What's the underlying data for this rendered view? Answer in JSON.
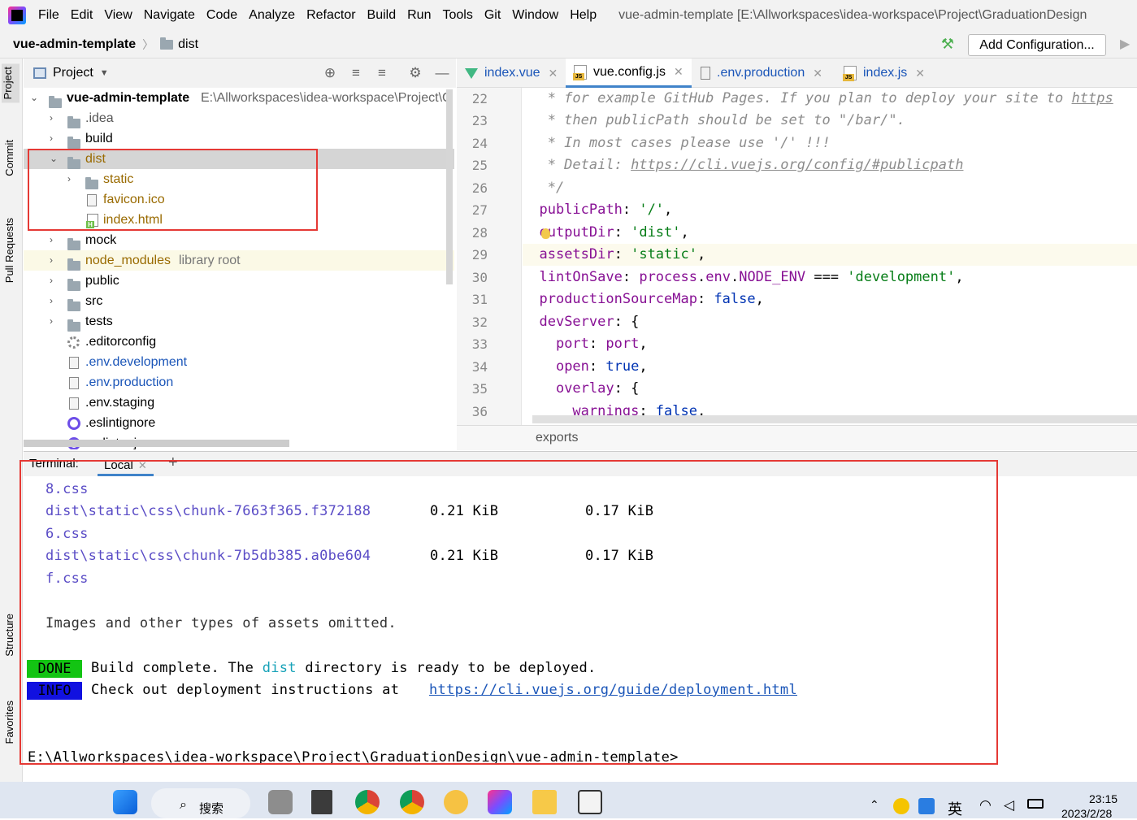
{
  "menubar": {
    "items": [
      "File",
      "Edit",
      "View",
      "Navigate",
      "Code",
      "Analyze",
      "Refactor",
      "Build",
      "Run",
      "Tools",
      "Git",
      "Window",
      "Help"
    ],
    "window_title": "vue-admin-template [E:\\Allworkspaces\\idea-workspace\\Project\\GraduationDesign"
  },
  "navbar": {
    "project": "vue-admin-template",
    "folder": "dist",
    "add_config": "Add Configuration..."
  },
  "sidebar_tabs": {
    "project": "Project",
    "commit": "Commit",
    "pull_requests": "Pull Requests",
    "structure": "Structure",
    "favorites": "Favorites"
  },
  "project_panel": {
    "title": "Project",
    "root_name": "vue-admin-template",
    "root_path": "E:\\Allworkspaces\\idea-workspace\\Project\\G",
    "items": [
      {
        "label": ".idea"
      },
      {
        "label": "build"
      },
      {
        "label": "dist"
      },
      {
        "label": "static"
      },
      {
        "label": "favicon.ico"
      },
      {
        "label": "index.html"
      },
      {
        "label": "mock"
      },
      {
        "label": "node_modules",
        "suffix": "library root"
      },
      {
        "label": "public"
      },
      {
        "label": "src"
      },
      {
        "label": "tests"
      },
      {
        "label": ".editorconfig"
      },
      {
        "label": ".env.development"
      },
      {
        "label": ".env.production"
      },
      {
        "label": ".env.staging"
      },
      {
        "label": ".eslintignore"
      },
      {
        "label": ".eslintrc.js"
      }
    ]
  },
  "editor": {
    "tabs": [
      {
        "label": "index.vue"
      },
      {
        "label": "vue.config.js"
      },
      {
        "label": ".env.production"
      },
      {
        "label": "index.js"
      }
    ],
    "line_numbers": [
      "22",
      "23",
      "24",
      "25",
      "26",
      "27",
      "28",
      "29",
      "30",
      "31",
      "32",
      "33",
      "34",
      "35",
      "36"
    ],
    "breadcrumb": "exports"
  },
  "terminal": {
    "title": "Terminal:",
    "tab": "Local",
    "lines": {
      "l1": "8.css",
      "l2_file": "dist\\static\\css\\chunk-7663f365.f372188",
      "l2_size": "0.21 KiB",
      "l2_gzip": "0.17 KiB",
      "l3": "6.css",
      "l4_file": "dist\\static\\css\\chunk-7b5db385.a0be604",
      "l4_size": "0.21 KiB",
      "l4_gzip": "0.17 KiB",
      "l5": "f.css",
      "omitted": "Images and other types of assets omitted.",
      "done_badge": "DONE",
      "done_pre": "Build complete. The ",
      "done_dist": "dist",
      "done_post": " directory is ready to be deployed.",
      "info_badge": "INFO",
      "info_pre": "Check out deployment instructions at ",
      "info_link": "https://cli.vuejs.org/guide/deployment.html",
      "prompt": "E:\\Allworkspaces\\idea-workspace\\Project\\GraduationDesign\\vue-admin-template>"
    }
  },
  "taskbar": {
    "search_label": "搜索",
    "ime": "英",
    "time": "23:15",
    "date": "2023/2/28"
  },
  "colors": {
    "highlight_box": "#e53935",
    "done_bg": "#13c413",
    "info_bg": "#1111e0",
    "accent": "#4083c9"
  }
}
